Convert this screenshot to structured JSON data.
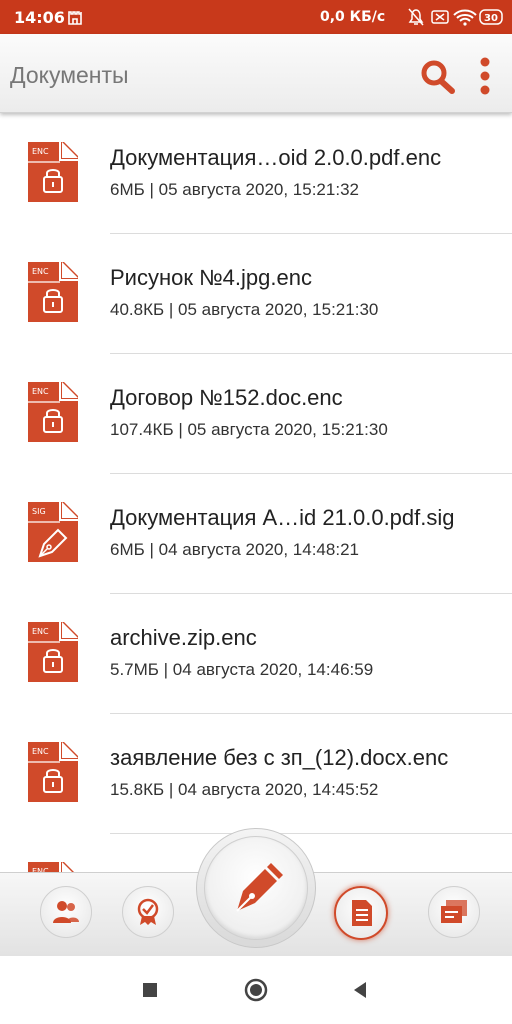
{
  "status_bar": {
    "time": "14:06",
    "speed": "0,0 КБ/с",
    "battery": "30"
  },
  "app_bar": {
    "title": "Документы"
  },
  "documents": [
    {
      "badge": "ENC",
      "type": "encrypted",
      "name": "Документация…oid 2.0.0.pdf.enc",
      "meta": "6МБ | 05 августа 2020, 15:21:32"
    },
    {
      "badge": "ENC",
      "type": "encrypted",
      "name": "Рисунок №4.jpg.enc",
      "meta": "40.8КБ | 05 августа 2020, 15:21:30"
    },
    {
      "badge": "ENC",
      "type": "encrypted",
      "name": "Договор №152.doc.enc",
      "meta": "107.4КБ | 05 августа 2020, 15:21:30"
    },
    {
      "badge": "SIG",
      "type": "signed",
      "name": "Документация А…id 21.0.0.pdf.sig",
      "meta": "6МБ | 04 августа 2020, 14:48:21"
    },
    {
      "badge": "ENC",
      "type": "encrypted",
      "name": "archive.zip.enc",
      "meta": "5.7МБ | 04 августа 2020, 14:46:59"
    },
    {
      "badge": "ENC",
      "type": "encrypted",
      "name": "заявление без с зп_(12).docx.enc",
      "meta": "15.8КБ | 04 августа 2020, 14:45:52"
    },
    {
      "badge": "ENC",
      "type": "encrypted",
      "name": "",
      "meta": ""
    }
  ],
  "colors": {
    "accent": "#c8391b",
    "icon_red": "#d04a2a"
  },
  "toolbar": {
    "buttons": [
      "contacts-icon",
      "certificate-icon",
      "sign-pen-icon",
      "documents-icon",
      "messages-icon"
    ],
    "active": "documents-icon"
  },
  "navigation": [
    "recents-icon",
    "home-icon",
    "back-icon"
  ]
}
